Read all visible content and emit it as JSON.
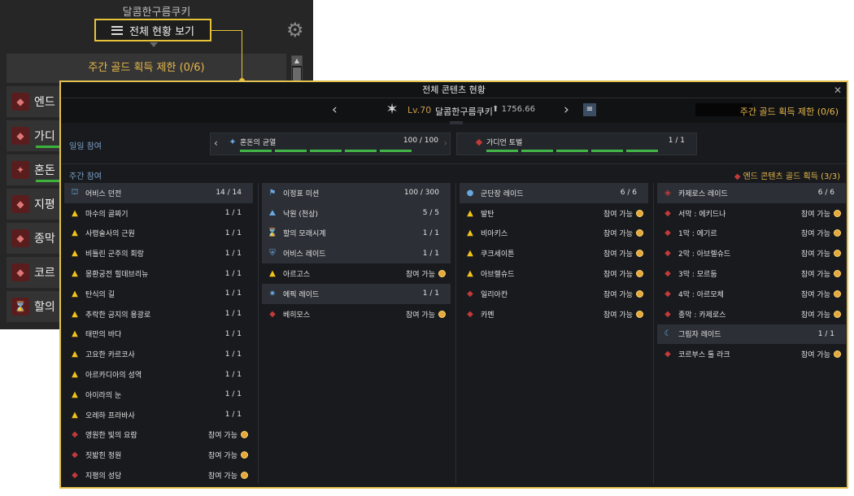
{
  "background": {
    "char_name": "달콤한구름쿠키",
    "view_all_label": "전체 현황 보기",
    "weekly_gold_label": "주간 골드 획득 제한 (0/6)",
    "rows": [
      {
        "label": "엔드",
        "icon": "raid-icon"
      },
      {
        "label": "가디",
        "icon": "guardian-icon"
      },
      {
        "label": "혼돈",
        "icon": "chaos-icon"
      },
      {
        "label": "지평",
        "icon": "raid-icon"
      },
      {
        "label": "종막",
        "icon": "raid-icon"
      },
      {
        "label": "코르",
        "icon": "raid-icon"
      },
      {
        "label": "할의",
        "icon": "hourglass-icon"
      }
    ]
  },
  "window": {
    "title": "전체 콘텐츠 현황",
    "level": "Lv.70",
    "char_name": "달콤한구름쿠키",
    "item_level": "1756.66",
    "weekly_gold": "주간 골드 획득 제한 (0/6)",
    "daily_label": "일일 참여",
    "weekly_label": "주간 참여",
    "end_gold": "엔드 콘텐츠 골드 획득 (3/3)",
    "daily": [
      {
        "name": "혼돈의 균열",
        "count": "100 / 100",
        "bars": 5
      },
      {
        "name": "가디언 토벌",
        "count": "1 / 1",
        "bars": 5
      }
    ],
    "columns": [
      {
        "header": {
          "name": "어비스 던전",
          "val": "14 / 14"
        },
        "rows": [
          {
            "name": "마수의 골짜기",
            "val": "1 / 1",
            "icon": "warn"
          },
          {
            "name": "사령술사의 근원",
            "val": "1 / 1",
            "icon": "warn"
          },
          {
            "name": "비틀린 군주의 회랑",
            "val": "1 / 1",
            "icon": "warn"
          },
          {
            "name": "몽환궁전 힐데브리뉴",
            "val": "1 / 1",
            "icon": "warn"
          },
          {
            "name": "탄식의 길",
            "val": "1 / 1",
            "icon": "warn"
          },
          {
            "name": "추락한 긍지의 용광로",
            "val": "1 / 1",
            "icon": "warn"
          },
          {
            "name": "태만의 바다",
            "val": "1 / 1",
            "icon": "warn"
          },
          {
            "name": "고요한 카르코사",
            "val": "1 / 1",
            "icon": "warn"
          },
          {
            "name": "아르카디아의 성역",
            "val": "1 / 1",
            "icon": "warn"
          },
          {
            "name": "아이라의 눈",
            "val": "1 / 1",
            "icon": "warn"
          },
          {
            "name": "오레하 프라바사",
            "val": "1 / 1",
            "icon": "warn"
          },
          {
            "name": "영원한 빛의 요람",
            "val": "참여 가능",
            "icon": "raid"
          },
          {
            "name": "짓밟힌 정원",
            "val": "참여 가능",
            "icon": "raid"
          },
          {
            "name": "지평의 성당",
            "val": "참여 가능",
            "icon": "raid"
          }
        ]
      },
      {
        "header": {
          "name": "이정표 미션",
          "val": "100 / 300"
        },
        "rows": [
          {
            "name": "낙원 (천상)",
            "val": "5 / 5",
            "icon": "paradise",
            "hdr": true
          },
          {
            "name": "할의 모래시계",
            "val": "1 / 1",
            "icon": "hourglass",
            "hdr": true
          },
          {
            "name": "어비스 레이드",
            "val": "1 / 1",
            "icon": "abyss",
            "hdr": true
          },
          {
            "name": "아르고스",
            "val": "참여 가능",
            "icon": "warn"
          },
          {
            "name": "에픽 레이드",
            "val": "1 / 1",
            "icon": "epic",
            "hdr": true
          },
          {
            "name": "베히모스",
            "val": "참여 가능",
            "icon": "raid"
          }
        ]
      },
      {
        "header": {
          "name": "군단장 레이드",
          "val": "6 / 6"
        },
        "rows": [
          {
            "name": "발탄",
            "val": "참여 가능",
            "icon": "warn"
          },
          {
            "name": "비아키스",
            "val": "참여 가능",
            "icon": "warn"
          },
          {
            "name": "쿠크세이튼",
            "val": "참여 가능",
            "icon": "warn"
          },
          {
            "name": "아브렐슈드",
            "val": "참여 가능",
            "icon": "warn"
          },
          {
            "name": "일리아칸",
            "val": "참여 가능",
            "icon": "raid"
          },
          {
            "name": "카멘",
            "val": "참여 가능",
            "icon": "raid"
          }
        ]
      },
      {
        "header": {
          "name": "카제로스 레이드",
          "val": "6 / 6"
        },
        "rows": [
          {
            "name": "서막 : 에키드나",
            "val": "참여 가능",
            "icon": "raid"
          },
          {
            "name": "1막 : 에기르",
            "val": "참여 가능",
            "icon": "raid"
          },
          {
            "name": "2막 : 아브렐슈드",
            "val": "참여 가능",
            "icon": "raid"
          },
          {
            "name": "3막 : 모르둠",
            "val": "참여 가능",
            "icon": "raid"
          },
          {
            "name": "4막 : 아르모체",
            "val": "참여 가능",
            "icon": "raid"
          },
          {
            "name": "종막 : 카제로스",
            "val": "참여 가능",
            "icon": "raid"
          },
          {
            "name": "그림자 레이드",
            "val": "1 / 1",
            "icon": "shadow",
            "hdr": true
          },
          {
            "name": "코르부스 툴 라크",
            "val": "참여 가능",
            "icon": "raid"
          }
        ]
      }
    ]
  }
}
